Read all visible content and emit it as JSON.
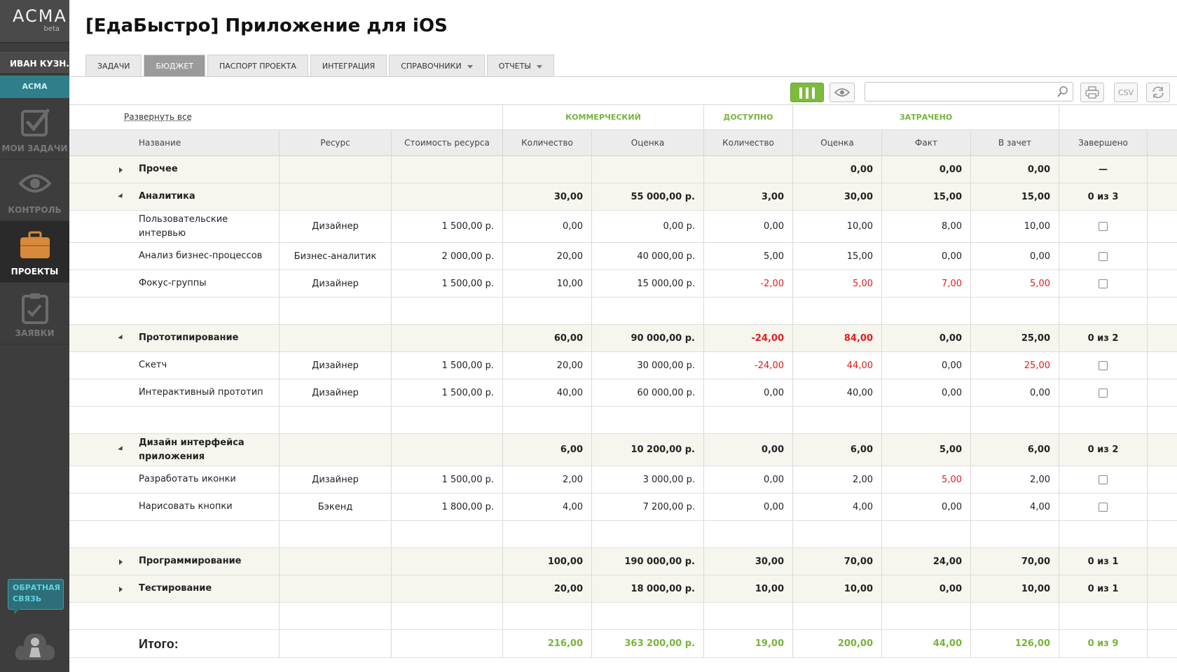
{
  "sidebar": {
    "logo": "ACMA",
    "logo_beta": "beta",
    "user": "ИВАН КУЗН...",
    "project_badge": "АСМА",
    "nav": [
      {
        "label": "МОИ ЗАДАЧИ",
        "icon": "checkbox-icon"
      },
      {
        "label": "КОНТРОЛЬ",
        "icon": "eye-icon"
      },
      {
        "label": "ПРОЕКТЫ",
        "icon": "briefcase-icon"
      },
      {
        "label": "ЗАЯВКИ",
        "icon": "clipboard-icon"
      }
    ],
    "feedback": "ОБРАТНАЯ СВЯЗЬ"
  },
  "page": {
    "title": "[ЕдаБыстро] Приложение для iOS"
  },
  "tabs": [
    {
      "label": "Задачи"
    },
    {
      "label": "Бюджет"
    },
    {
      "label": "Паспорт проекта"
    },
    {
      "label": "Интеграция"
    },
    {
      "label": "Справочники"
    },
    {
      "label": "Отчеты"
    }
  ],
  "toolbar": {
    "search_placeholder": "",
    "csv_label": "CSV"
  },
  "table": {
    "expand_all": "Развернуть все",
    "groups": {
      "commercial": "коммерческий",
      "available": "доступно",
      "spent": "затрачено"
    },
    "columns": [
      "Название",
      "Ресурс",
      "Стоимость ресурса",
      "Количество",
      "Оценка",
      "Количество",
      "Оценка",
      "Факт",
      "В зачет",
      "Завершено"
    ],
    "rows": [
      {
        "kind": "group",
        "toggle": "collapsed",
        "name": "Прочее",
        "resource": "",
        "cost": "",
        "qty": "",
        "estimate": "",
        "avail_qty": "",
        "spent_est": "0,00",
        "fact": "0,00",
        "credit": "0,00",
        "done": "—"
      },
      {
        "kind": "group",
        "toggle": "expanded",
        "name": "Аналитика",
        "resource": "",
        "cost": "",
        "qty": "30,00",
        "estimate": "55 000,00 р.",
        "avail_qty": "3,00",
        "spent_est": "30,00",
        "fact": "15,00",
        "credit": "15,00",
        "done": "0 из 3"
      },
      {
        "kind": "task",
        "name": "Пользовательские интервью",
        "resource": "Дизайнер",
        "cost": "1 500,00 р.",
        "qty": "0,00",
        "estimate": "0,00 р.",
        "avail_qty": "0,00",
        "spent_est": "10,00",
        "fact": "8,00",
        "credit": "10,00",
        "done": "checkbox"
      },
      {
        "kind": "task",
        "name": "Анализ бизнес-процессов",
        "resource": "Бизнес-аналитик",
        "cost": "2 000,00 р.",
        "qty": "20,00",
        "estimate": "40 000,00 р.",
        "avail_qty": "5,00",
        "spent_est": "15,00",
        "fact": "0,00",
        "credit": "0,00",
        "done": "checkbox"
      },
      {
        "kind": "task",
        "name": "Фокус-группы",
        "resource": "Дизайнер",
        "cost": "1 500,00 р.",
        "qty": "10,00",
        "estimate": "15 000,00 р.",
        "avail_qty": "-2,00",
        "spent_est": "5,00",
        "fact": "7,00",
        "credit": "5,00",
        "done": "checkbox",
        "neg": [
          "avail_qty",
          "spent_est",
          "fact",
          "credit"
        ]
      },
      {
        "kind": "spacer"
      },
      {
        "kind": "group",
        "toggle": "expanded",
        "name": "Прототипирование",
        "resource": "",
        "cost": "",
        "qty": "60,00",
        "estimate": "90 000,00 р.",
        "avail_qty": "-24,00",
        "spent_est": "84,00",
        "fact": "0,00",
        "credit": "25,00",
        "done": "0 из 2",
        "neg": [
          "avail_qty",
          "spent_est"
        ]
      },
      {
        "kind": "task",
        "name": "Скетч",
        "resource": "Дизайнер",
        "cost": "1 500,00 р.",
        "qty": "20,00",
        "estimate": "30 000,00 р.",
        "avail_qty": "-24,00",
        "spent_est": "44,00",
        "fact": "0,00",
        "credit": "25,00",
        "done": "checkbox",
        "neg": [
          "avail_qty",
          "spent_est",
          "credit"
        ]
      },
      {
        "kind": "task",
        "name": "Интерактивный прототип",
        "resource": "Дизайнер",
        "cost": "1 500,00 р.",
        "qty": "40,00",
        "estimate": "60 000,00 р.",
        "avail_qty": "0,00",
        "spent_est": "40,00",
        "fact": "0,00",
        "credit": "0,00",
        "done": "checkbox"
      },
      {
        "kind": "spacer"
      },
      {
        "kind": "group",
        "toggle": "expanded",
        "name": "Дизайн интерфейса приложения",
        "resource": "",
        "cost": "",
        "qty": "6,00",
        "estimate": "10 200,00 р.",
        "avail_qty": "0,00",
        "spent_est": "6,00",
        "fact": "5,00",
        "credit": "6,00",
        "done": "0 из 2"
      },
      {
        "kind": "task",
        "name": "Разработать иконки",
        "resource": "Дизайнер",
        "cost": "1 500,00 р.",
        "qty": "2,00",
        "estimate": "3 000,00 р.",
        "avail_qty": "0,00",
        "spent_est": "2,00",
        "fact": "5,00",
        "credit": "2,00",
        "done": "checkbox",
        "neg": [
          "fact"
        ]
      },
      {
        "kind": "task",
        "name": "Нарисовать кнопки",
        "resource": "Бэкенд",
        "cost": "1 800,00 р.",
        "qty": "4,00",
        "estimate": "7 200,00 р.",
        "avail_qty": "0,00",
        "spent_est": "4,00",
        "fact": "0,00",
        "credit": "4,00",
        "done": "checkbox"
      },
      {
        "kind": "spacer"
      },
      {
        "kind": "group",
        "toggle": "collapsed",
        "name": "Программирование",
        "resource": "",
        "cost": "",
        "qty": "100,00",
        "estimate": "190 000,00 р.",
        "avail_qty": "30,00",
        "spent_est": "70,00",
        "fact": "24,00",
        "credit": "70,00",
        "done": "0 из 1"
      },
      {
        "kind": "group",
        "toggle": "collapsed",
        "name": "Тестирование",
        "resource": "",
        "cost": "",
        "qty": "20,00",
        "estimate": "18 000,00 р.",
        "avail_qty": "10,00",
        "spent_est": "10,00",
        "fact": "0,00",
        "credit": "10,00",
        "done": "0 из 1"
      },
      {
        "kind": "spacer"
      },
      {
        "kind": "total",
        "name": "Итого:",
        "resource": "",
        "cost": "",
        "qty": "216,00",
        "estimate": "363 200,00 р.",
        "avail_qty": "19,00",
        "spent_est": "200,00",
        "fact": "44,00",
        "credit": "126,00",
        "done": "0 из 9"
      }
    ]
  }
}
